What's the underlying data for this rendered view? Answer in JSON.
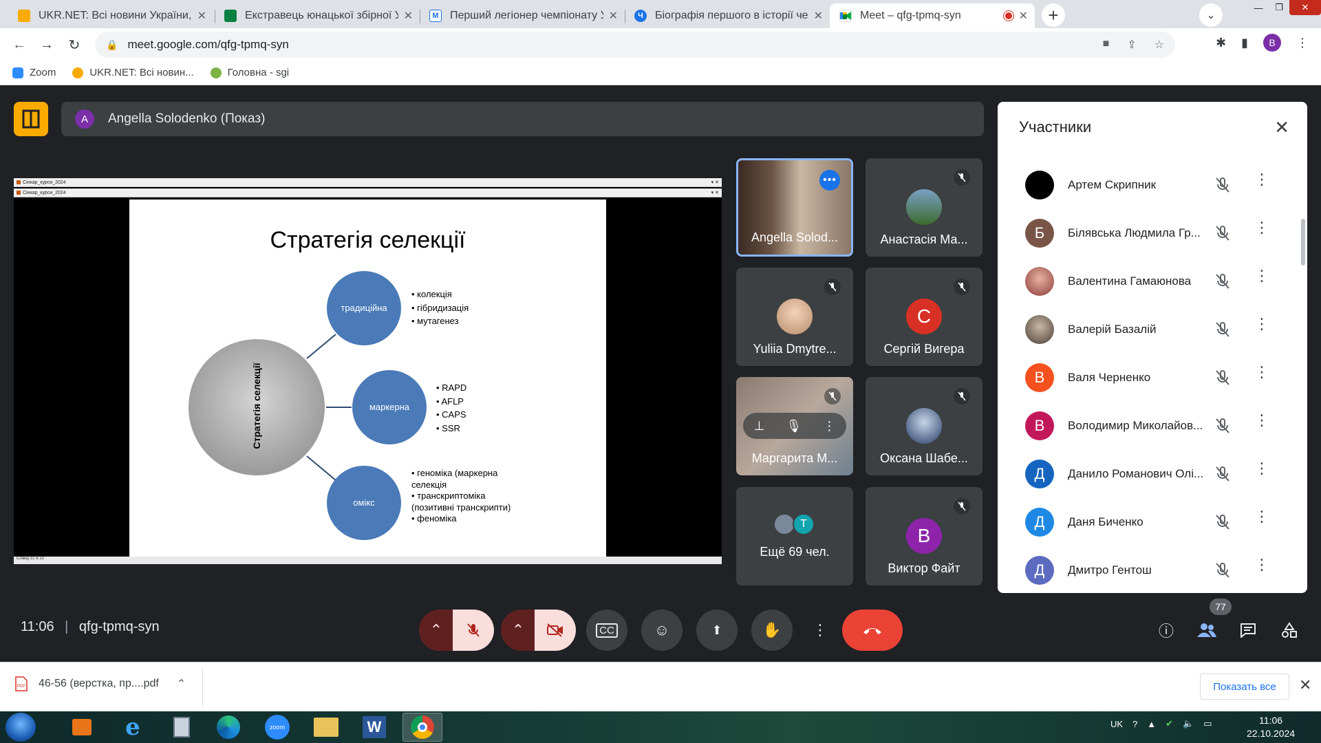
{
  "browser": {
    "tabs": [
      {
        "title": "UKR.NET: Всі новини України, ос",
        "active": false
      },
      {
        "title": "Екстравець юнацької збірної Ук",
        "active": false
      },
      {
        "title": "Перший легіонер чемпіонату Ук",
        "active": false
      },
      {
        "title": "Біографія першого в історії чем",
        "active": false
      },
      {
        "title": "Meet – qfg-tpmq-syn",
        "active": true
      }
    ],
    "url": "meet.google.com/qfg-tpmq-syn",
    "profile_initial": "B",
    "bookmarks": [
      "Zoom",
      "UKR.NET: Всі новин...",
      "Головна - sgi"
    ]
  },
  "meet": {
    "presenter_initial": "A",
    "presenter_label": "Angella Solodenko (Показ)",
    "meeting_time": "11:06",
    "meeting_code": "qfg-tpmq-syn",
    "participant_count": "77",
    "slide": {
      "window_tab": "Сінкар_курси_2024",
      "status": "Слайд 11 із 22",
      "title": "Стратегія селекції",
      "center_label": "Стратегія селекції",
      "branches": [
        {
          "label": "традиційна",
          "items": [
            "колекція",
            "гібридизація",
            "мутагенез"
          ]
        },
        {
          "label": "маркерна",
          "items": [
            "RAPD",
            "AFLP",
            "CAPS",
            "SSR"
          ]
        },
        {
          "label": "омікс",
          "items": [
            "геноміка (маркерна селекція",
            "транскриптоміка (позитивні транскрипти)",
            "феноміка"
          ]
        }
      ]
    },
    "tiles": [
      {
        "name": "Angella Solod...",
        "type": "video"
      },
      {
        "name": "Анастасія Ма...",
        "type": "photo"
      },
      {
        "name": "Yuliia Dmytre...",
        "type": "photo"
      },
      {
        "name": "Сергій Вигера",
        "initial": "С",
        "color": "#d93025"
      },
      {
        "name": "Маргарита М...",
        "type": "video"
      },
      {
        "name": "Оксана Шабе...",
        "type": "photo"
      },
      {
        "name": "Ещё 69 чел.",
        "initial": "Т",
        "color": "#12a4af"
      },
      {
        "name": "Виктор Файт",
        "initial": "В",
        "color": "#8e24aa"
      }
    ],
    "panel": {
      "title": "Участники",
      "people": [
        {
          "name": "Артем Скрипник",
          "initial": "",
          "color": "#000000"
        },
        {
          "name": "Білявська Людмила Гр...",
          "initial": "Б",
          "color": "#795548"
        },
        {
          "name": "Валентина Гамаюнова",
          "initial": "",
          "color": "#b48a78"
        },
        {
          "name": "Валерій Базалій",
          "initial": "",
          "color": "#6d5e50"
        },
        {
          "name": "Валя Черненко",
          "initial": "В",
          "color": "#f4511e"
        },
        {
          "name": "Володимир Миколайов...",
          "initial": "В",
          "color": "#c2185b"
        },
        {
          "name": "Данило Романович Олі...",
          "initial": "Д",
          "color": "#1565c0"
        },
        {
          "name": "Даня Биченко",
          "initial": "Д",
          "color": "#1e88e5"
        },
        {
          "name": "Дмитро Гентош",
          "initial": "Д",
          "color": "#5c6bc0"
        }
      ]
    }
  },
  "downloads": {
    "file": "46-56 (верстка, пр....pdf",
    "show_all": "Показать все"
  },
  "taskbar": {
    "lang": "UK",
    "time": "11:06",
    "date": "22.10.2024"
  }
}
